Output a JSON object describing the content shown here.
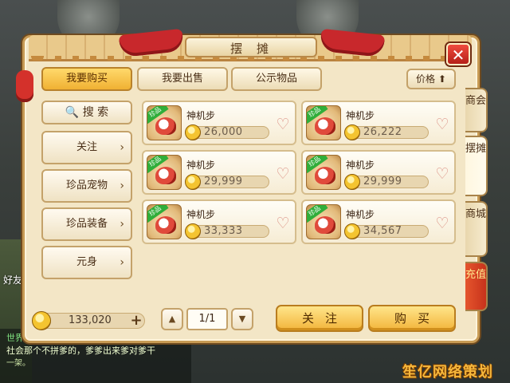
{
  "title": "摆摊",
  "close_label": "✕",
  "tabs": [
    {
      "label": "我要购买",
      "active": true
    },
    {
      "label": "我要出售",
      "active": false
    },
    {
      "label": "公示物品",
      "active": false
    }
  ],
  "sort": {
    "label": "价格",
    "arrow": "⬆"
  },
  "search": {
    "icon": "search-icon",
    "label": "🔍 搜 索"
  },
  "categories": [
    {
      "label": "关注",
      "chevron": "›"
    },
    {
      "label": "珍品宠物",
      "chevron": "›"
    },
    {
      "label": "珍品装备",
      "chevron": "›"
    },
    {
      "label": "元身",
      "chevron": "›"
    }
  ],
  "items": [
    {
      "tag": "珍品",
      "name": "神机步",
      "price": "26,000",
      "heart": "♡"
    },
    {
      "tag": "珍品",
      "name": "神机步",
      "price": "26,222",
      "heart": "♡"
    },
    {
      "tag": "珍品",
      "name": "神机步",
      "price": "29,999",
      "heart": "♡"
    },
    {
      "tag": "珍品",
      "name": "神机步",
      "price": "29,999",
      "heart": "♡"
    },
    {
      "tag": "珍品",
      "name": "神机步",
      "price": "33,333",
      "heart": "♡"
    },
    {
      "tag": "珍品",
      "name": "神机步",
      "price": "34,567",
      "heart": "♡"
    }
  ],
  "side_tabs": [
    {
      "label": "商会"
    },
    {
      "label": "摆摊",
      "active": true
    },
    {
      "label": "商城"
    },
    {
      "label": "充值"
    }
  ],
  "balance": {
    "amount": "133,020",
    "plus": "+"
  },
  "pager": {
    "prev": "▲",
    "current": "1/1",
    "next": "▼"
  },
  "actions": {
    "follow": "关注",
    "buy": "购买"
  },
  "background": {
    "player_name": "好友",
    "chat_line1": "世界",
    "chat_line2": "社会那个不拼爹的，爹爹出来爹对爹干",
    "chat_line3": "一架。"
  },
  "watermark": "笙亿网络策划",
  "colors": {
    "accent": "#f2b43a",
    "panel": "#f3e6c6",
    "recharge": "#d9401f"
  }
}
